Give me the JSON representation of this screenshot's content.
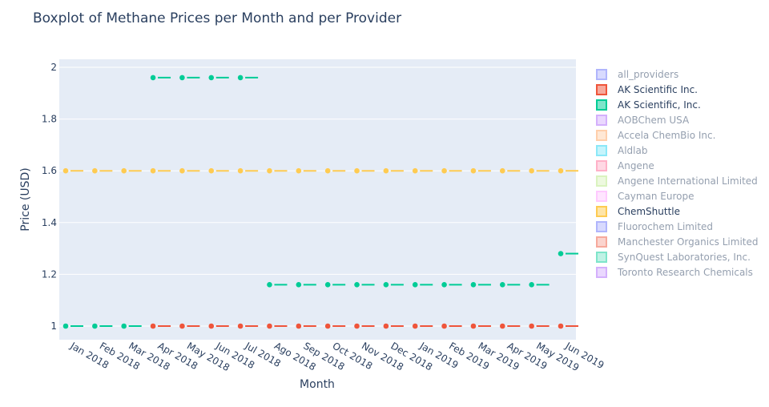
{
  "chart_data": {
    "type": "box",
    "title": "Boxplot of Methane Prices per Month and per Provider",
    "xlabel": "Month",
    "ylabel": "Price (USD)",
    "categories": [
      "Jan 2018",
      "Feb 2018",
      "Mar 2018",
      "Apr 2018",
      "May 2018",
      "Jun 2018",
      "Jul 2018",
      "Ago 2018",
      "Sep 2018",
      "Oct 2018",
      "Nov 2018",
      "Dec 2018",
      "Jan 2019",
      "Feb 2019",
      "Mar 2019",
      "Apr 2019",
      "May 2019",
      "Jun 2019"
    ],
    "ylim": [
      0.95,
      2.02
    ],
    "yticks": [
      {
        "value": 1,
        "label": "1"
      },
      {
        "value": 1.2,
        "label": "1.2"
      },
      {
        "value": 1.4,
        "label": "1.4"
      },
      {
        "value": 1.6,
        "label": "1.6"
      },
      {
        "value": 1.8,
        "label": "1.8"
      },
      {
        "value": 2,
        "label": "2"
      }
    ],
    "grid": true,
    "legend_position": "right",
    "series": [
      {
        "name": "all_providers",
        "color": "#636efa",
        "visible": false,
        "values": []
      },
      {
        "name": "AK Scientific Inc.",
        "color": "#ef553b",
        "visible": true,
        "values": [
          null,
          null,
          null,
          1,
          1,
          1,
          1,
          1,
          1,
          1,
          1,
          1,
          1,
          1,
          1,
          1,
          1,
          1
        ]
      },
      {
        "name": "AK Scientific, Inc.",
        "color": "#00cc96",
        "visible": true,
        "values": [
          1,
          1,
          1,
          1.96,
          1.96,
          1.96,
          1.96,
          1.16,
          1.16,
          1.16,
          1.16,
          1.16,
          1.16,
          1.16,
          1.16,
          1.16,
          1.16,
          1.28
        ]
      },
      {
        "name": "AOBChem USA",
        "color": "#ab63fa",
        "visible": false,
        "values": []
      },
      {
        "name": "Accela ChemBio Inc.",
        "color": "#ffa15a",
        "visible": false,
        "values": []
      },
      {
        "name": "Aldlab",
        "color": "#19d3f3",
        "visible": false,
        "values": []
      },
      {
        "name": "Angene",
        "color": "#ff6692",
        "visible": false,
        "values": []
      },
      {
        "name": "Angene International Limited",
        "color": "#b6e880",
        "visible": false,
        "values": []
      },
      {
        "name": "Cayman Europe",
        "color": "#ff97ff",
        "visible": false,
        "values": []
      },
      {
        "name": "ChemShuttle",
        "color": "#fecb52",
        "visible": true,
        "values": [
          1.6,
          1.6,
          1.6,
          1.6,
          1.6,
          1.6,
          1.6,
          1.6,
          1.6,
          1.6,
          1.6,
          1.6,
          1.6,
          1.6,
          1.6,
          1.6,
          1.6,
          1.6
        ]
      },
      {
        "name": "Fluorochem Limited",
        "color": "#636efa",
        "visible": false,
        "values": []
      },
      {
        "name": "Manchester Organics Limited",
        "color": "#ef553b",
        "visible": false,
        "values": []
      },
      {
        "name": "SynQuest Laboratories, Inc.",
        "color": "#00cc96",
        "visible": false,
        "values": []
      },
      {
        "name": "Toronto Research Chemicals",
        "color": "#ab63fa",
        "visible": false,
        "values": []
      }
    ]
  }
}
